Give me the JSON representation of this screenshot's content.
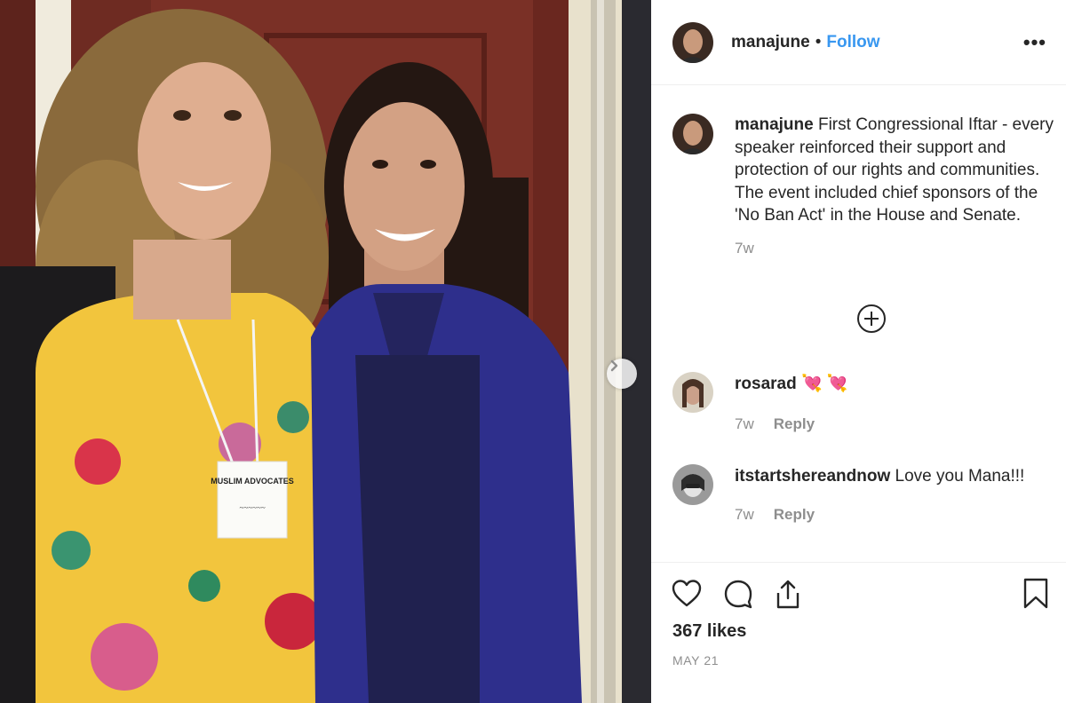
{
  "post": {
    "author": "manajune",
    "follow_label": "Follow",
    "separator": "•",
    "more_label": "•••",
    "caption_text": "First Congressional Iftar - every speaker reinforced their support and protection of our rights and communities. The event included chief sponsors of the 'No Ban Act' in the House and Senate.",
    "caption_age": "7w",
    "likes": "367 likes",
    "date": "MAY 21",
    "badge_org": "MUSLIM ADVOCATES"
  },
  "comments": [
    {
      "username": "rosarad",
      "text": "💘 💘",
      "age": "7w",
      "reply_label": "Reply"
    },
    {
      "username": "itstartshereandnow",
      "text": "Love you Mana!!!",
      "age": "7w",
      "reply_label": "Reply"
    }
  ],
  "icons": {
    "load_more": "plus-circle-icon",
    "like": "heart-icon",
    "comment": "comment-icon",
    "share": "share-icon",
    "save": "bookmark-icon",
    "next": "chevron-right-icon"
  },
  "colors": {
    "link": "#3897f0",
    "text": "#262626",
    "muted": "#8e8e8e",
    "border": "#efefef"
  }
}
